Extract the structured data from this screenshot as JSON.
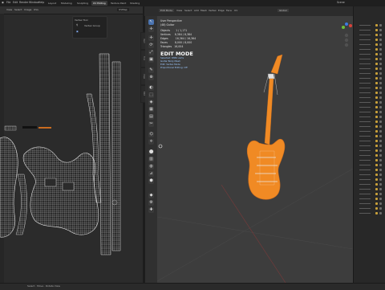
{
  "app": {
    "menu": [
      "File",
      "Edit",
      "Render",
      "Window",
      "Help"
    ],
    "workspace_tabs": [
      "Layout",
      "Modeling",
      "Sculpting",
      "UV Editing",
      "Texture Paint",
      "Shading"
    ],
    "active_workspace": "UV Editing",
    "scene_label": "Scene"
  },
  "uv_editor": {
    "header_buttons": [
      "View",
      "Select",
      "Image",
      "UVs"
    ],
    "image_field": "UVMap",
    "panel_title": "Vertex Tool",
    "panel_row": "Vertex Group"
  },
  "viewport": {
    "mode_dropdown": "Edit Mode",
    "header_menus": [
      "View",
      "Select",
      "Add",
      "Mesh",
      "Vertex",
      "Edge",
      "Face",
      "UV"
    ],
    "transform_dropdown": "Global",
    "stats": {
      "view": "User Perspective",
      "collection": "(48) Guitar",
      "objects_label": "Objects",
      "objects_value": "1 / 1,171",
      "vertices_label": "Vertices",
      "vertices_value": "8,384 / 8,384",
      "edges_label": "Edges",
      "edges_value": "16,364 / 16,364",
      "faces_label": "Faces",
      "faces_value": "8,000 / 8,000",
      "triangles_label": "Triangles",
      "triangles_value": "16,004",
      "mode_title": "EDIT MODE",
      "line1": "Selected: 8384 verts",
      "line2": "Guitar Body Mesh",
      "line3": "Edit: Vertex Mode",
      "line4": "Proportional Editing: Off"
    },
    "tools": [
      "↖",
      "✛",
      "⟳",
      "⤢",
      "▣",
      "✎",
      "⊕",
      "◐",
      "✂",
      "⌬",
      "⬚",
      "◈",
      "▦",
      "▤",
      "⟡",
      "⬤",
      "▥",
      "◍",
      "⊿",
      "⬢",
      "◆",
      "⚙",
      "✚"
    ],
    "side_tabs": [
      "Item",
      "Tool",
      "View",
      "Edit"
    ]
  },
  "status_bar": {
    "text": "Select · Move · Rotate View"
  },
  "colors": {
    "accent": "#4a73b0",
    "guitar": "#f08a24",
    "wire": "#cccccc"
  }
}
